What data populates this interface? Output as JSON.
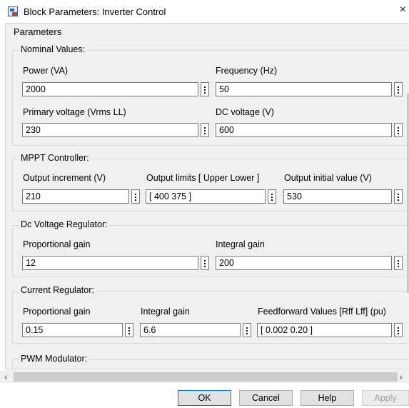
{
  "window": {
    "title": "Block Parameters: Inverter Control",
    "close_glyph": "×"
  },
  "parameters_label": "Parameters",
  "groups": {
    "nominal": {
      "label": "Nominal Values:",
      "power": {
        "label": "Power (VA)",
        "value": "2000"
      },
      "frequency": {
        "label": "Frequency (Hz)",
        "value": "50"
      },
      "primary_voltage": {
        "label": "Primary voltage (Vrms LL)",
        "value": "230"
      },
      "dc_voltage": {
        "label": "DC voltage (V)",
        "value": "600"
      }
    },
    "mppt": {
      "label": "MPPT Controller:",
      "output_increment": {
        "label": "Output increment (V)",
        "value": "210"
      },
      "output_limits": {
        "label": "Output limits [ Upper  Lower ]",
        "value": "[ 400 375 ]"
      },
      "output_initial": {
        "label": "Output initial value (V)",
        "value": "530"
      }
    },
    "dc_regulator": {
      "label": "Dc Voltage Regulator:",
      "proportional_gain": {
        "label": "Proportional gain",
        "value": "12"
      },
      "integral_gain": {
        "label": "Integral gain",
        "value": "200"
      }
    },
    "current_regulator": {
      "label": "Current Regulator:",
      "proportional_gain": {
        "label": "Proportional gain",
        "value": "0.15"
      },
      "integral_gain": {
        "label": "Integral gain",
        "value": "6.6"
      },
      "feedforward": {
        "label": "Feedforward Values [Rff Lff] (pu)",
        "value": "[ 0.002 0.20 ]"
      }
    },
    "pwm": {
      "label": "PWM Modulator:"
    }
  },
  "scrollbar": {
    "left_arrow": "‹",
    "right_arrow": "›"
  },
  "buttons": {
    "ok": "OK",
    "cancel": "Cancel",
    "help": "Help",
    "apply": "Apply"
  },
  "icons": {
    "app": "simulink-block-icon",
    "field_menu": "vertical-ellipsis-icon"
  },
  "colors": {
    "dialog_bg": "#f0f0f0",
    "default_button_border": "#0078d7"
  }
}
